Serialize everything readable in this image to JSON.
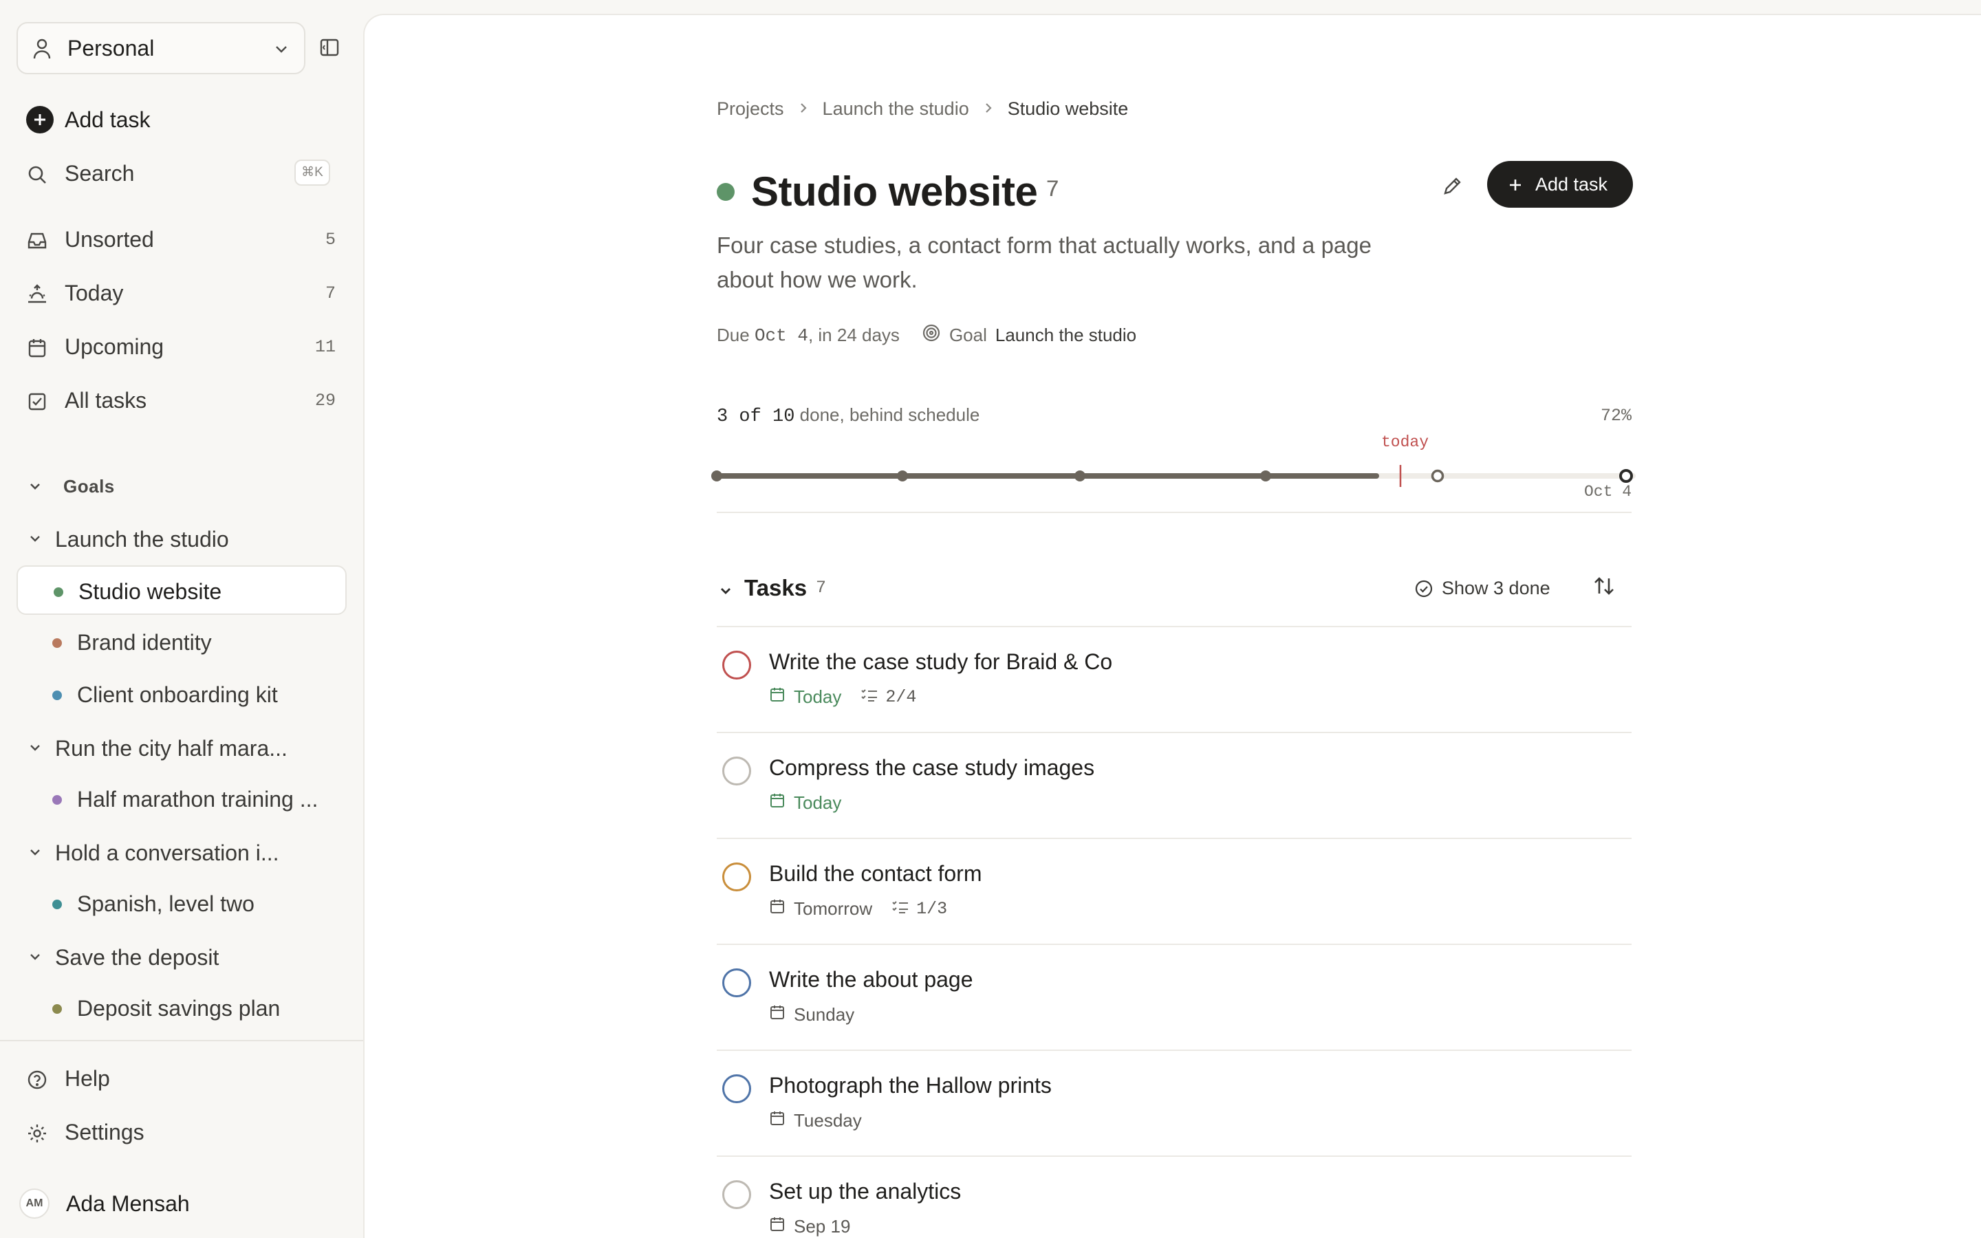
{
  "sidebar": {
    "workspace": "Personal",
    "add_task": "Add task",
    "search": {
      "label": "Search",
      "shortcut": "⌘K"
    },
    "nav": [
      {
        "label": "Unsorted",
        "count": "5"
      },
      {
        "label": "Today",
        "count": "7"
      },
      {
        "label": "Upcoming",
        "count": "11"
      },
      {
        "label": "All tasks",
        "count": "29"
      }
    ],
    "goals_heading": "Goals",
    "goals": [
      {
        "label": "Launch the studio"
      },
      {
        "label": "Run the city half mara..."
      },
      {
        "label": "Hold a conversation i..."
      },
      {
        "label": "Save the deposit"
      }
    ],
    "projects": [
      {
        "label": "Studio website",
        "color": "#5e9468"
      },
      {
        "label": "Brand identity",
        "color": "#b97a5e"
      },
      {
        "label": "Client onboarding kit",
        "color": "#4e8fb1"
      },
      {
        "label": "Half marathon training ...",
        "color": "#9a78b8"
      },
      {
        "label": "Spanish, level two",
        "color": "#3f8f94"
      },
      {
        "label": "Deposit savings plan",
        "color": "#8c8a4e"
      }
    ],
    "help": "Help",
    "settings": "Settings",
    "user": {
      "initials": "AM",
      "name": "Ada Mensah"
    }
  },
  "main": {
    "breadcrumb": [
      "Projects",
      "Launch the studio",
      "Studio website"
    ],
    "title": "Studio website",
    "title_count": "7",
    "project_color": "#5e9468",
    "add_task_button": "Add task",
    "description": "Four case studies, a contact form that actually works, and a page about how we work.",
    "due_prefix": "Due",
    "due_date": "Oct 4",
    "due_suffix": ", in 24 days",
    "goal_label": "Goal",
    "goal_name": "Launch the studio",
    "progress": {
      "done": "3 of 10",
      "status": "done, behind schedule",
      "percent_label": "72%",
      "elapsed_fraction": 0.72,
      "today_label": "today",
      "end_label": "Oct 4"
    },
    "tasks_section": {
      "label": "Tasks",
      "count": "7",
      "show_done": "Show 3 done"
    },
    "tasks": [
      {
        "title": "Write the case study for Braid & Co",
        "date": "Today",
        "subtasks": "2/4",
        "ring_color": "#c0504f",
        "date_color": "#4a8a5c"
      },
      {
        "title": "Compress the case study images",
        "date": "Today",
        "subtasks": "",
        "ring_color": "#bdb9b2",
        "date_color": "#4a8a5c"
      },
      {
        "title": "Build the contact form",
        "date": "Tomorrow",
        "subtasks": "1/3",
        "ring_color": "#c98e3b",
        "date_color": "#5b5955"
      },
      {
        "title": "Write the about page",
        "date": "Sunday",
        "subtasks": "",
        "ring_color": "#4f74a8",
        "date_color": "#5b5955"
      },
      {
        "title": "Photograph the Hallow prints",
        "date": "Tuesday",
        "subtasks": "",
        "ring_color": "#4f74a8",
        "date_color": "#5b5955"
      },
      {
        "title": "Set up the analytics",
        "date": "Sep 19",
        "subtasks": "",
        "ring_color": "#bdb9b2",
        "date_color": "#5b5955"
      }
    ]
  }
}
